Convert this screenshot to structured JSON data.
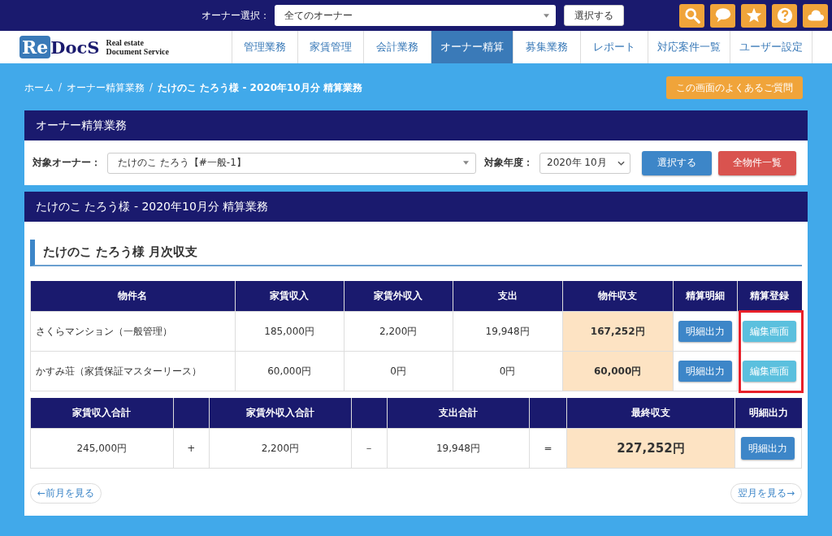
{
  "top_bar": {
    "owner_select_label": "オーナー選択：",
    "owner_select_value": "全てのオーナー",
    "select_button": "選択する"
  },
  "nav": {
    "brand_mark": "Re",
    "brand_name": "DocS",
    "brand_tagline_1": "Real estate",
    "brand_tagline_2": "Document Service",
    "items": [
      {
        "label": "管理業務",
        "selected": false
      },
      {
        "label": "家賃管理",
        "selected": false
      },
      {
        "label": "会計業務",
        "selected": false
      },
      {
        "label": "オーナー精算",
        "selected": true
      },
      {
        "label": "募集業務",
        "selected": false
      },
      {
        "label": "レポート",
        "selected": false
      },
      {
        "label": "対応案件一覧",
        "selected": false
      },
      {
        "label": "ユーザー設定",
        "selected": false
      }
    ]
  },
  "breadcrumb_separator": "/",
  "breadcrumb": [
    {
      "label": "ホーム",
      "current": false
    },
    {
      "label": "オーナー精算業務",
      "current": false
    },
    {
      "label": "たけのこ たろう様 - 2020年10月分 精算業務",
      "current": true
    }
  ],
  "faq_button": "この画面のよくあるご質問",
  "filter_panel": {
    "title": "オーナー精算業務",
    "owner_label": "対象オーナー：",
    "owner_value": "たけのこ たろう【#一般-1】",
    "year_label": "対象年度：",
    "year_value": "2020年 10月",
    "select_button": "選択する",
    "all_properties_button": "全物件一覧"
  },
  "settlement_panel": {
    "title": "たけのこ たろう様 - 2020年10月分 精算業務",
    "section_heading": "たけのこ たろう様 月次収支",
    "table": {
      "columns": [
        "物件名",
        "家賃収入",
        "家賃外収入",
        "支出",
        "物件収支",
        "精算明細",
        "精算登録"
      ],
      "highlighted_column": true,
      "rows": [
        {
          "name": "さくらマンション（一般管理）",
          "rent": "185,000円",
          "other_income": "2,200円",
          "expense": "19,948円",
          "balance": "167,252円",
          "detail_button": "明細出力",
          "edit_button": "編集画面"
        },
        {
          "name": "かすみ荘（家賃保証マスターリース）",
          "rent": "60,000円",
          "other_income": "0円",
          "expense": "0円",
          "balance": "60,000円",
          "detail_button": "明細出力",
          "edit_button": "編集画面"
        }
      ]
    },
    "totals": {
      "columns": [
        "家賃収入合計",
        "家賃外収入合計",
        "支出合計",
        "最終収支",
        "明細出力"
      ],
      "rent_total": "245,000円",
      "op_plus": "+",
      "other_total": "2,200円",
      "op_minus": "－",
      "expense_total": "19,948円",
      "op_equals": "=",
      "final_balance": "227,252円",
      "detail_button": "明細出力"
    },
    "prev_button": "←前月を見る",
    "next_button": "翌月を見る→"
  }
}
